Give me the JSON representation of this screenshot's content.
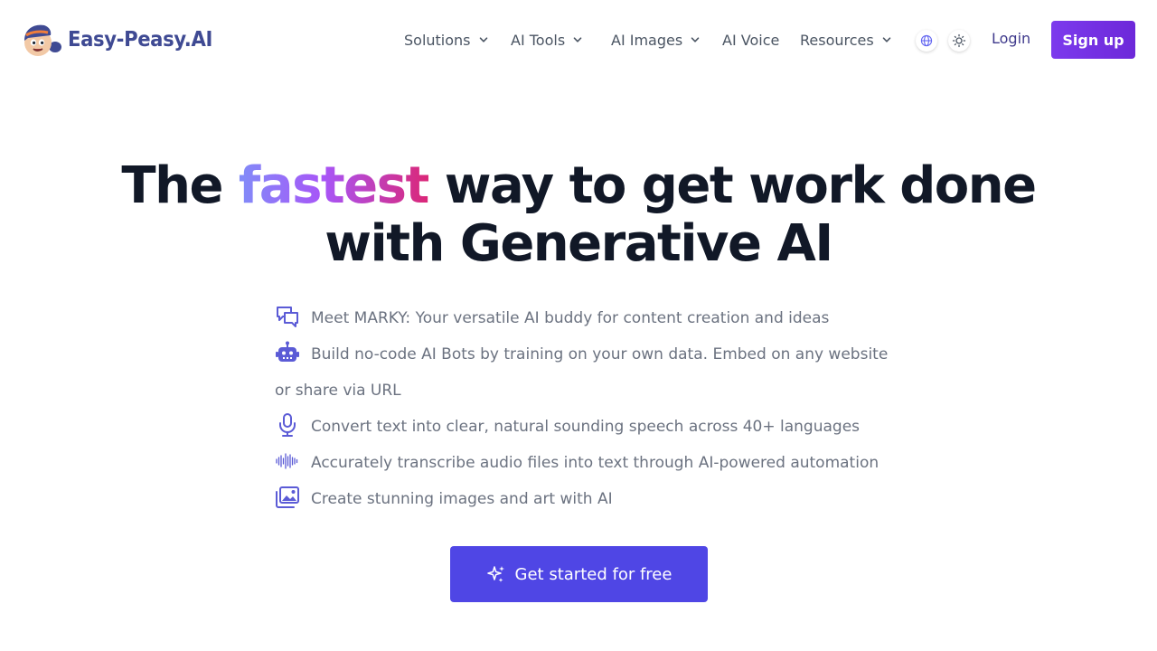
{
  "brand": {
    "name": "Easy-Peasy.AI"
  },
  "nav": {
    "solutions": "Solutions",
    "ai_tools": "AI Tools",
    "ai_images": "AI Images",
    "ai_voice": "AI Voice",
    "resources": "Resources"
  },
  "header_actions": {
    "login": "Login",
    "signup": "Sign up"
  },
  "hero": {
    "title_part1": "The ",
    "title_highlight": "fastest",
    "title_part2": " way to get work done",
    "title_line2": "with Generative AI",
    "features": [
      {
        "icon": "chat-bubbles-icon",
        "text": "Meet MARKY: Your versatile AI buddy for content creation and ideas"
      },
      {
        "icon": "robot-icon",
        "text": "Build no-code AI Bots by training on your own data. Embed on any website or share via URL"
      },
      {
        "icon": "microphone-icon",
        "text": "Convert text into clear, natural sounding speech across 40+ languages"
      },
      {
        "icon": "waveform-icon",
        "text": "Accurately transcribe audio files into text through AI-powered automation"
      },
      {
        "icon": "images-icon",
        "text": "Create stunning images and art with AI"
      }
    ],
    "cta": "Get started for free"
  },
  "colors": {
    "brand_text": "#3f4a93",
    "primary": "#4f46e5",
    "signup_gradient": [
      "#7c3aed",
      "#6d28d9"
    ],
    "highlight_gradient": [
      "#818cf8",
      "#a855f7",
      "#db2777"
    ],
    "icon_color": "#5b5bd6"
  }
}
